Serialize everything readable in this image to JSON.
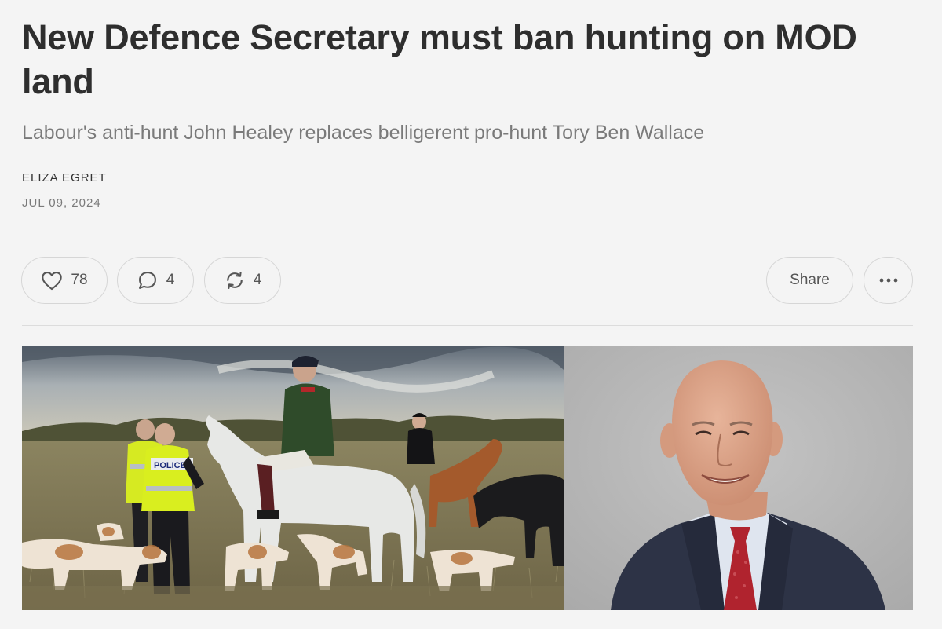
{
  "article": {
    "title": "New Defence Secretary must ban hunting on MOD land",
    "subtitle": "Labour's anti-hunt John Healey replaces belligerent pro-hunt Tory Ben Wallace",
    "author": "ELIZA EGRET",
    "date": "JUL 09, 2024"
  },
  "actions": {
    "likes": "78",
    "comments": "4",
    "restacks": "4",
    "share_label": "Share"
  },
  "images": {
    "left_vest_text": "POLICE"
  },
  "colors": {
    "background": "#f4f4f4",
    "title": "#2e2e2e",
    "subtitle": "#7a7a7a",
    "border": "#d6d6d6"
  }
}
